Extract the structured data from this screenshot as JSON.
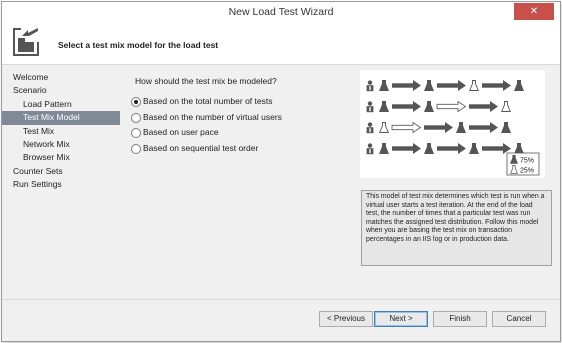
{
  "window": {
    "title": "New Load Test Wizard",
    "close_symbol": "✕"
  },
  "header": {
    "heading": "Select a test mix model for the load test"
  },
  "nav": {
    "items": [
      {
        "label": "Welcome",
        "indent": false,
        "selected": false
      },
      {
        "label": "Scenario",
        "indent": false,
        "selected": false
      },
      {
        "label": "Load Pattern",
        "indent": true,
        "selected": false
      },
      {
        "label": "Test Mix Model",
        "indent": true,
        "selected": true
      },
      {
        "label": "Test Mix",
        "indent": true,
        "selected": false
      },
      {
        "label": "Network Mix",
        "indent": true,
        "selected": false
      },
      {
        "label": "Browser Mix",
        "indent": true,
        "selected": false
      },
      {
        "label": "Counter Sets",
        "indent": false,
        "selected": false
      },
      {
        "label": "Run Settings",
        "indent": false,
        "selected": false
      }
    ]
  },
  "main": {
    "question": "How should the test mix be modeled?",
    "options": [
      {
        "label": "Based on the total number of tests",
        "selected": true
      },
      {
        "label": "Based on the number of virtual users",
        "selected": false
      },
      {
        "label": "Based on user pace",
        "selected": false
      },
      {
        "label": "Based on sequential test order",
        "selected": false
      }
    ],
    "legend": {
      "pct_a": "75%",
      "pct_b": "25%"
    },
    "description": "This model of test mix determines which test is run when a virtual user starts a test iteration. At the end of the load test, the number of times that a particular test was run matches the assigned test distribution. Follow this model when you are basing the test mix on transaction percentages in an IIS log or in production data."
  },
  "footer": {
    "previous": "< Previous",
    "next": "Next >",
    "finish": "Finish",
    "cancel": "Cancel"
  },
  "colors": {
    "selected_nav": "#7f8a96",
    "close_button": "#c7504b",
    "icon_dark": "#555555"
  }
}
